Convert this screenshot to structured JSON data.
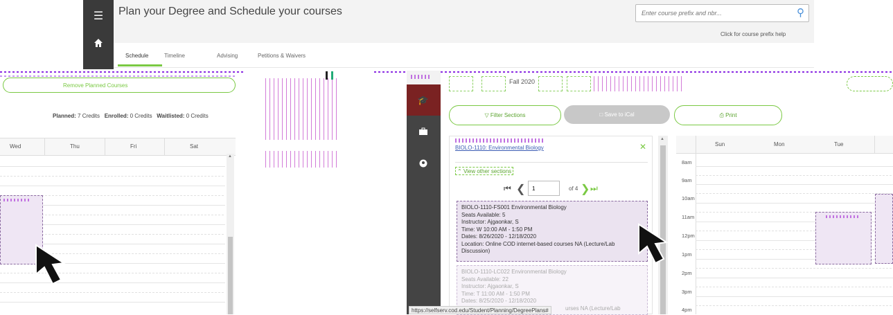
{
  "header": {
    "title": "Plan your Degree and Schedule your courses",
    "search_placeholder": "Enter course prefix and nbr...",
    "prefix_help": "Click for course prefix help"
  },
  "tabs": [
    {
      "label": "Schedule",
      "active": true
    },
    {
      "label": "Timeline",
      "active": false
    },
    {
      "label": "Advising",
      "active": false
    },
    {
      "label": "Petitions & Waivers",
      "active": false
    }
  ],
  "left_panel": {
    "remove_planned_label": "Remove Planned Courses",
    "planned_label": "Planned:",
    "planned_value": "7 Credits",
    "enrolled_label": "Enrolled:",
    "enrolled_value": "0 Credits",
    "waitlisted_label": "Waitlisted:",
    "waitlisted_value": "0 Credits",
    "days": [
      "Wed",
      "Thu",
      "Fri",
      "Sat"
    ]
  },
  "term_nav": {
    "term": "Fall 2020"
  },
  "actions": {
    "filter_label": "Filter Sections",
    "ical_label": "Save to iCal",
    "print_label": "Print"
  },
  "course_panel": {
    "course_title": "BIOLO-1110: Environmental Biology",
    "view_other_label": "View other sections",
    "page_current": "1",
    "page_of": "of 4",
    "sections": [
      {
        "title": "BIOLO-1110-FS001 Environmental Biology",
        "seats": "Seats Available: 5",
        "instructor": "Instructor: Ajgaonkar, S",
        "time": "Time: W 10:00 AM - 1:50 PM",
        "dates": "Dates: 8/26/2020 - 12/18/2020",
        "location": "Location: Online COD internet-based courses NA (Lecture/Lab Discussion)"
      },
      {
        "title": "BIOLO-1110-LC022 Environmental Biology",
        "seats": "Seats Available: 22",
        "instructor": "Instructor: Ajgaonkar, S",
        "time": "Time: T 11:00 AM - 1:50 PM",
        "dates": "Dates: 8/25/2020 - 12/18/2020",
        "location": "urses NA (Lecture/Lab"
      }
    ]
  },
  "right_calendar": {
    "days": [
      "Sun",
      "Mon",
      "Tue"
    ],
    "times": [
      "8am",
      "9am",
      "10am",
      "11am",
      "12pm",
      "1pm",
      "2pm",
      "3pm",
      "4pm"
    ]
  },
  "status_url": "https://selfserv.cod.edu/Student/Planning/DegreePlans#",
  "colors": {
    "accent_green": "#7ac943",
    "maroon": "#7a2222",
    "dark_sidebar": "#444444",
    "event_fill": "#efe6f4"
  }
}
